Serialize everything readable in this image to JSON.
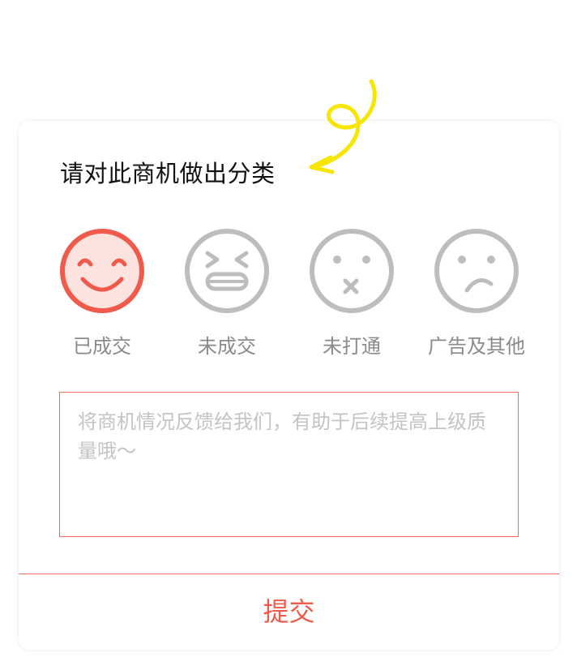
{
  "dialog": {
    "title": "请对此商机做出分类",
    "options": [
      {
        "label": "已成交",
        "icon": "smile-icon",
        "selected": true
      },
      {
        "label": "未成交",
        "icon": "grimace-icon",
        "selected": false
      },
      {
        "label": "未打通",
        "icon": "mouth-x-icon",
        "selected": false
      },
      {
        "label": "广告及其他",
        "icon": "frown-icon",
        "selected": false
      }
    ],
    "feedback": {
      "value": "",
      "placeholder": "将商机情况反馈给我们，有助于后续提高上级质量哦～"
    },
    "submit_label": "提交"
  },
  "colors": {
    "accent": "#f05a4b",
    "accent_fill": "#fde3e0",
    "unselected": "#bdbdbd",
    "arrow": "#f7e600"
  }
}
